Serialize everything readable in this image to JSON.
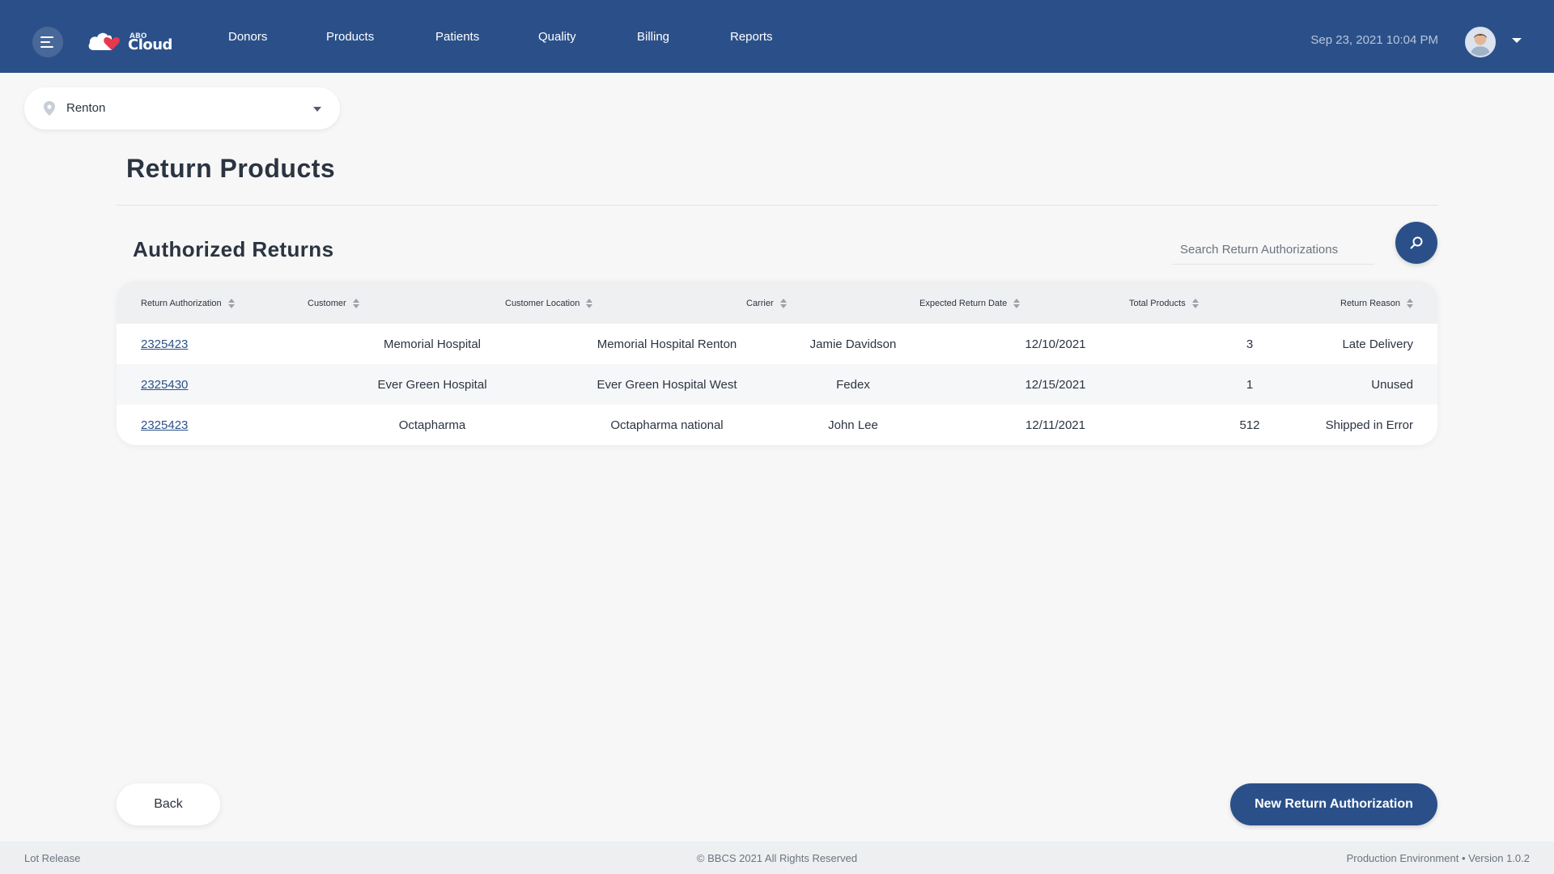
{
  "header": {
    "logo_small": "ABO",
    "logo_big": "Cloud",
    "nav": [
      "Donors",
      "Products",
      "Patients",
      "Quality",
      "Billing",
      "Reports"
    ],
    "datetime": "Sep 23, 2021 10:04 PM"
  },
  "location": {
    "value": "Renton"
  },
  "page_title": "Return Products",
  "section_title": "Authorized Returns",
  "search": {
    "placeholder": "Search Return Authorizations"
  },
  "table": {
    "columns": [
      "Return Authorization",
      "Customer",
      "Customer Location",
      "Carrier",
      "Expected Return Date",
      "Total Products",
      "Return Reason"
    ],
    "rows": [
      [
        "2325423",
        "Memorial Hospital",
        "Memorial Hospital Renton",
        "Jamie Davidson",
        "12/10/2021",
        "3",
        "Late Delivery"
      ],
      [
        "2325430",
        "Ever Green Hospital",
        "Ever Green Hospital West",
        "Fedex",
        "12/15/2021",
        "1",
        "Unused"
      ],
      [
        "2325423",
        "Octapharma",
        "Octapharma national",
        "John Lee",
        "12/11/2021",
        "512",
        "Shipped in Error"
      ]
    ]
  },
  "buttons": {
    "back": "Back",
    "new": "New Return Authorization"
  },
  "footer": {
    "left": "Lot Release",
    "center": "© BBCS 2021 All Rights Reserved",
    "right": "Production Environment  •  Version 1.0.2"
  },
  "colors": {
    "brand": "#2b5089",
    "logo_accent": "#e8384f"
  }
}
